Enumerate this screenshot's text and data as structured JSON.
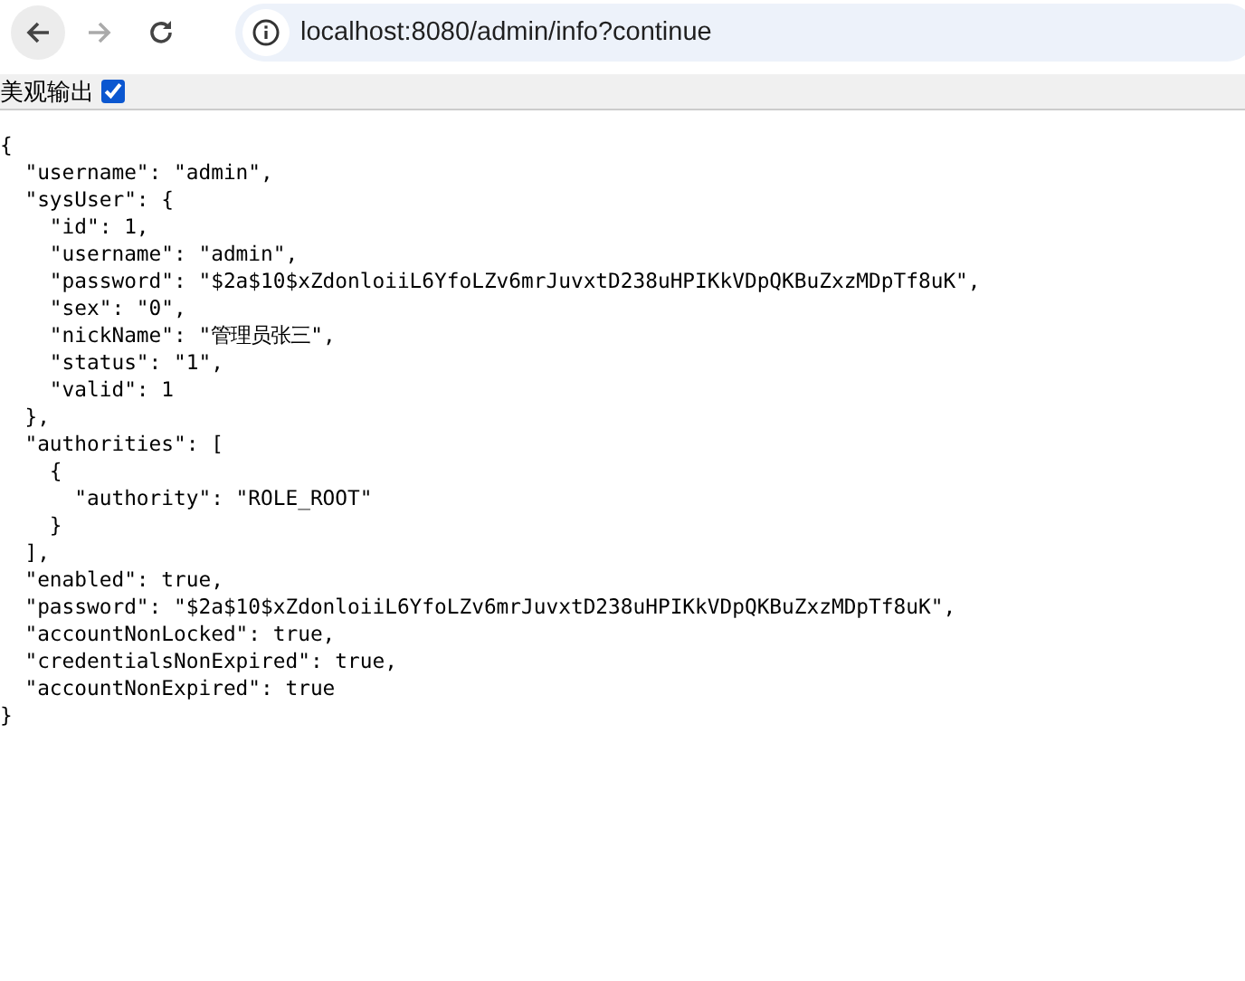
{
  "toolbar": {
    "back": {
      "disabled": false
    },
    "forward": {
      "disabled": true
    },
    "address": "localhost:8080/admin/info?continue"
  },
  "pretty_print": {
    "label": "美观输出",
    "checked": true
  },
  "lines": [
    "{",
    "  \"username\": \"admin\",",
    "  \"sysUser\": {",
    "    \"id\": 1,",
    "    \"username\": \"admin\",",
    "    \"password\": \"$2a$10$xZdonloiiL6YfoLZv6mrJuvxtD238uHPIKkVDpQKBuZxzMDpTf8uK\",",
    "    \"sex\": \"0\",",
    "    \"nickName\": \"管理员张三\",",
    "    \"status\": \"1\",",
    "    \"valid\": 1",
    "  },",
    "  \"authorities\": [",
    "    {",
    "      \"authority\": \"ROLE_ROOT\"",
    "    }",
    "  ],",
    "  \"enabled\": true,",
    "  \"password\": \"$2a$10$xZdonloiiL6YfoLZv6mrJuvxtD238uHPIKkVDpQKBuZxzMDpTf8uK\",",
    "  \"accountNonLocked\": true,",
    "  \"credentialsNonExpired\": true,",
    "  \"accountNonExpired\": true",
    "}"
  ]
}
